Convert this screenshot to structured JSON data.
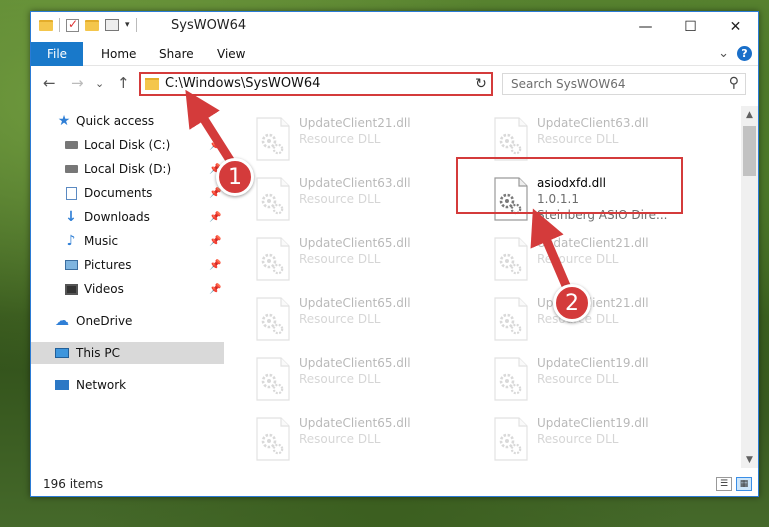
{
  "window": {
    "title": "SysWOW64"
  },
  "titlebar": {
    "minimize_glyph": "—",
    "maximize_glyph": "☐",
    "close_glyph": "✕"
  },
  "ribbon": {
    "tabs": [
      "File",
      "Home",
      "Share",
      "View"
    ],
    "expand_glyph": "⌄",
    "help_glyph": "?"
  },
  "nav": {
    "back_glyph": "←",
    "forward_glyph": "→",
    "recent_glyph": "⌄",
    "up_glyph": "↑",
    "address": "C:\\Windows\\SysWOW64",
    "dropdown_glyph": "⌄",
    "refresh_glyph": "↻",
    "search_placeholder": "Search SysWOW64",
    "search_glyph": "⚲"
  },
  "sidebar": {
    "items": [
      {
        "label": "Quick access",
        "icon": "star-icon",
        "pinned": false
      },
      {
        "label": "Local Disk (C:)",
        "icon": "drive-icon",
        "pinned": true
      },
      {
        "label": "Local Disk (D:)",
        "icon": "drive-icon",
        "pinned": true
      },
      {
        "label": "Documents",
        "icon": "document-icon",
        "pinned": true
      },
      {
        "label": "Downloads",
        "icon": "download-icon",
        "pinned": true
      },
      {
        "label": "Music",
        "icon": "music-icon",
        "pinned": true
      },
      {
        "label": "Pictures",
        "icon": "picture-icon",
        "pinned": true
      },
      {
        "label": "Videos",
        "icon": "video-icon",
        "pinned": true
      },
      {
        "label": "OneDrive",
        "icon": "cloud-icon",
        "pinned": false
      },
      {
        "label": "This PC",
        "icon": "computer-icon",
        "pinned": false,
        "selected": true
      },
      {
        "label": "Network",
        "icon": "network-icon",
        "pinned": false
      }
    ]
  },
  "files": [
    {
      "name": "UpdateClient21.dll",
      "sub1": "Resource DLL",
      "faded": true
    },
    {
      "name": "UpdateClient63.dll",
      "sub1": "Resource DLL",
      "faded": true
    },
    {
      "name": "UpdateClient63.dll",
      "sub1": "Resource DLL",
      "faded": true
    },
    {
      "name": "asiodxfd.dll",
      "sub1": "1.0.1.1",
      "sub2": "Steinberg ASIO Dire...",
      "faded": false
    },
    {
      "name": "UpdateClient65.dll",
      "sub1": "Resource DLL",
      "faded": true
    },
    {
      "name": "UpdateClient21.dll",
      "sub1": "Resource DLL",
      "faded": true
    },
    {
      "name": "UpdateClient65.dll",
      "sub1": "Resource DLL",
      "faded": true
    },
    {
      "name": "UpdateClient21.dll",
      "sub1": "Resource DLL",
      "faded": true
    },
    {
      "name": "UpdateClient65.dll",
      "sub1": "Resource DLL",
      "faded": true
    },
    {
      "name": "UpdateClient19.dll",
      "sub1": "Resource DLL",
      "faded": true
    },
    {
      "name": "UpdateClient65.dll",
      "sub1": "Resource DLL",
      "faded": true
    },
    {
      "name": "UpdateClient19.dll",
      "sub1": "Resource DLL",
      "faded": true
    }
  ],
  "status": {
    "item_count": "196 items"
  },
  "scroll": {
    "up_glyph": "▲",
    "down_glyph": "▼"
  },
  "annotations": {
    "step1": "1",
    "step2": "2",
    "color": "#d43b3b"
  }
}
